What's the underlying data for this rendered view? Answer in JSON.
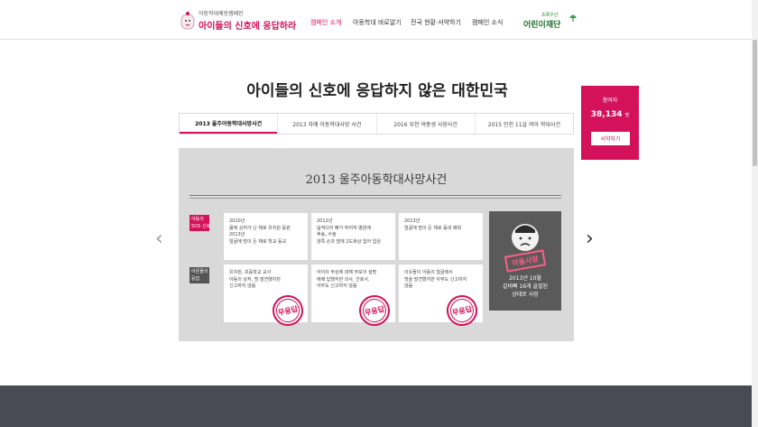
{
  "header": {
    "logo_small": "아동학대예방캠페인",
    "logo_big": "아이들의 신호에 응답하라",
    "nav": [
      "캠페인 소개",
      "아동학대 바로알기",
      "전국 현황·서약하기",
      "캠페인 소식"
    ],
    "active_nav": 0,
    "brand_small": "초록우산",
    "brand_big": "어린이재단"
  },
  "main_title": "아이들의 신호에 응답하지 않은 대한민국",
  "tabs": [
    "2013 울주아동학대사망사건",
    "2013 자매 아동학대사망 사건",
    "2016 부천 여중생 사망사건",
    "2015 인천 11살 여아 학대사건"
  ],
  "active_tab": 0,
  "case": {
    "title": "2013 울주아동학대사망사건",
    "row1_label": [
      "아동의",
      "SOS 신호"
    ],
    "row2_label": [
      "어른들의",
      "응답"
    ],
    "signals": [
      [
        "2010년",
        "몸에 상처가 난 채로 유치원 등원",
        "2013년",
        "얼굴에 멍이 든 채로 학교 등교"
      ],
      [
        "2012년",
        "넓적다리 뼈가 부러져 병원에",
        "후송, 수술",
        "양쪽 손과 발에 2도화상 입어 입원"
      ],
      [
        "2013년",
        "얼굴에 멍이 든 채로 동네 배회"
      ]
    ],
    "responses": [
      [
        "유치원, 초등학교 교사",
        "아동의 상처, 멍 발견했지만",
        "신고하지 않음"
      ],
      [
        "아이의 부상에 대해 부모의 설명",
        "애매 답했지만 의사, 간호사,",
        "아무도 신고하지 않음"
      ],
      [
        "이웃들이 아동의 얼굴에서",
        "멍을 발견했지만 아무도 신고하지",
        "않음"
      ]
    ],
    "stamp_label": "무응답",
    "victim_stamp": "아동사망",
    "victim_text": [
      "2013년 10월",
      "갈비뼈 16개 골절된",
      "상태로 사망"
    ]
  },
  "participants": {
    "label": "참여자",
    "count": "38,134",
    "unit": "명",
    "button": "서약하기"
  },
  "colors": {
    "accent": "#d3125b",
    "stage_bg": "#d9d9d9",
    "footer": "#4a4a55"
  },
  "icons": {
    "prev": "chevron-left-icon",
    "next": "chevron-right-icon"
  }
}
